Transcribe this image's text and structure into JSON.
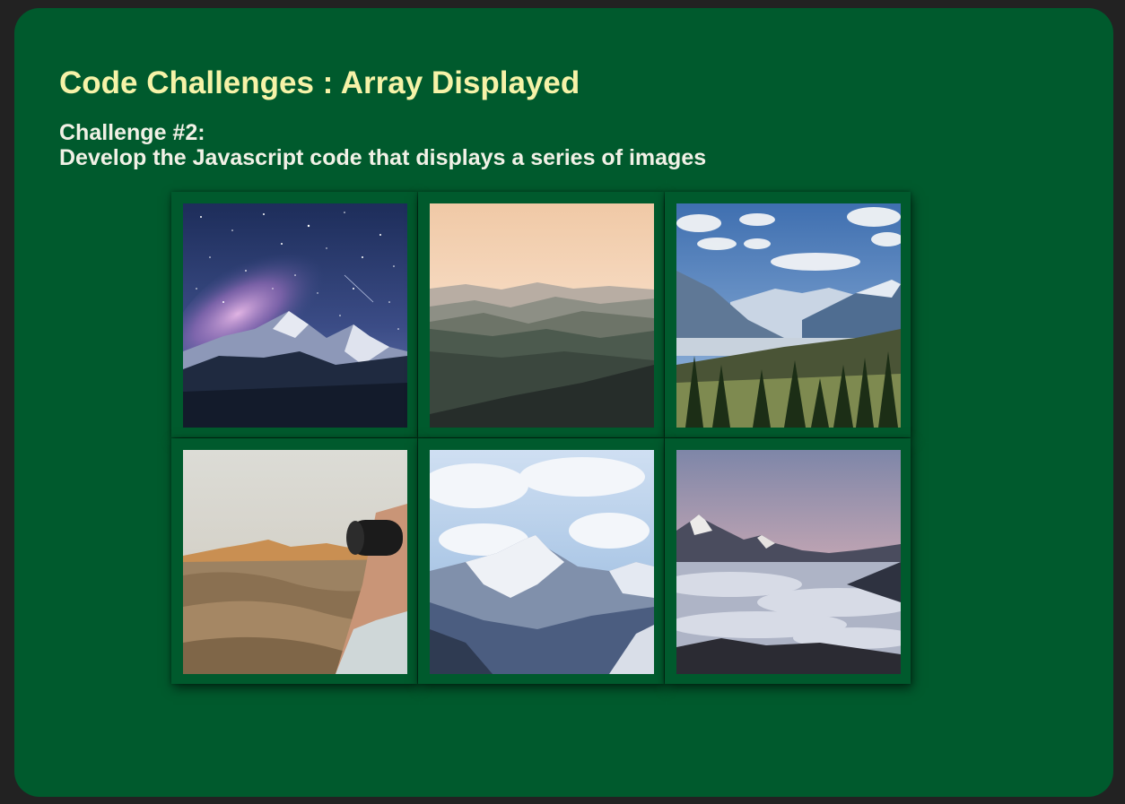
{
  "page": {
    "title": "Code Challenges : Array Displayed",
    "challenge_label": "Challenge #2:",
    "challenge_description": "Develop the Javascript code that displays a series of images"
  },
  "colors": {
    "page_background": "#222222",
    "panel_background": "#005a2d",
    "title_color": "#f6f3a8",
    "subtitle_color": "#f1f1e6"
  },
  "gallery": {
    "images": [
      {
        "subject": "starry night sky over snowy mountain"
      },
      {
        "subject": "misty layered hills at dusk"
      },
      {
        "subject": "mountain valley with pine forest"
      },
      {
        "subject": "desert dunes with photographer holding camera"
      },
      {
        "subject": "snow-capped mountain peak under clouds"
      },
      {
        "subject": "mountain peaks above sea of clouds at sunset"
      }
    ]
  }
}
